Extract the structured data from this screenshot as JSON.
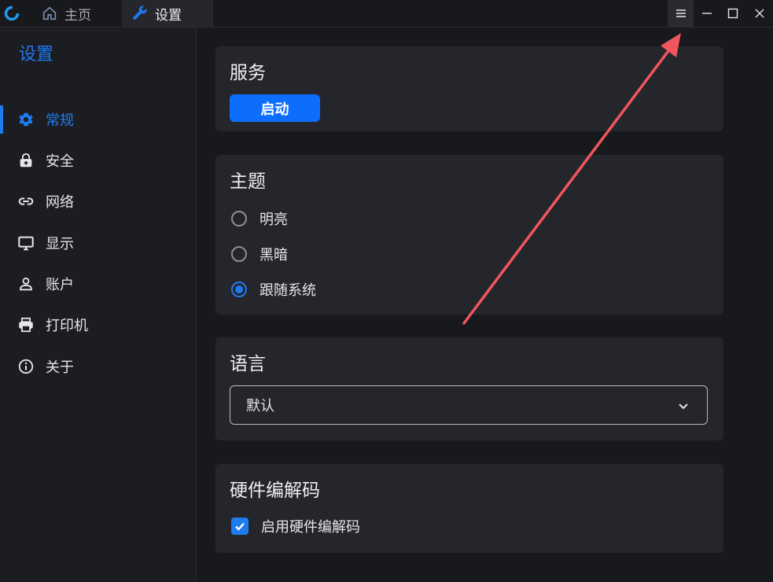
{
  "tabs": [
    {
      "label": "主页",
      "icon": "home-icon"
    },
    {
      "label": "设置",
      "icon": "wrench-icon"
    }
  ],
  "window_controls": [
    "menu-icon",
    "minimize-icon",
    "maximize-icon",
    "close-icon"
  ],
  "sidebar": {
    "title": "设置",
    "items": [
      {
        "label": "常规",
        "icon": "gear-icon",
        "active": true
      },
      {
        "label": "安全",
        "icon": "lock-icon"
      },
      {
        "label": "网络",
        "icon": "link-icon"
      },
      {
        "label": "显示",
        "icon": "monitor-icon"
      },
      {
        "label": "账户",
        "icon": "user-icon"
      },
      {
        "label": "打印机",
        "icon": "printer-icon"
      },
      {
        "label": "关于",
        "icon": "info-icon"
      }
    ]
  },
  "service": {
    "title": "服务",
    "button_label": "启动"
  },
  "theme": {
    "title": "主题",
    "options": [
      {
        "label": "明亮",
        "checked": false
      },
      {
        "label": "黑暗",
        "checked": false
      },
      {
        "label": "跟随系统",
        "checked": true
      }
    ]
  },
  "language": {
    "title": "语言",
    "selected": "默认"
  },
  "hardware_codec": {
    "title": "硬件编解码",
    "checkbox_label": "启用硬件编解码",
    "checked": true
  },
  "colors": {
    "accent": "#1e7bf0",
    "background": "#18191d",
    "card": "#25262b",
    "annotation_arrow": "#f0565c"
  }
}
